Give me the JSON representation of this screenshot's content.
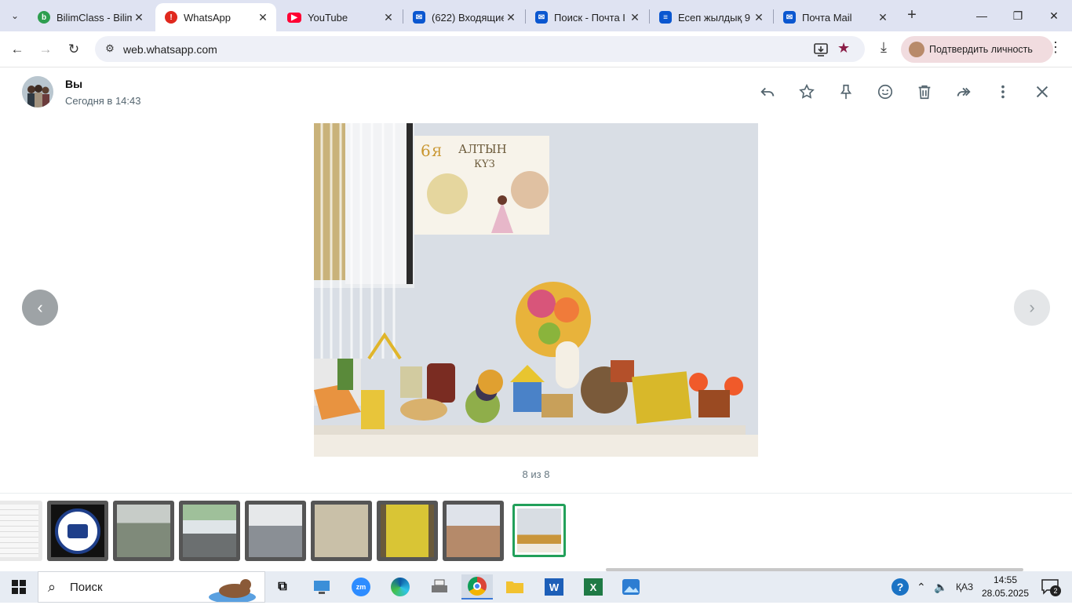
{
  "browser": {
    "tabs": [
      {
        "title": "BilimClass - Bilim",
        "favicon": "bilimclass-icon",
        "color": "#2e9e4f",
        "active": false
      },
      {
        "title": "WhatsApp",
        "favicon": "whatsapp-alert-icon",
        "color": "#e0291e",
        "active": true
      },
      {
        "title": "YouTube",
        "favicon": "youtube-icon",
        "color": "#ff0033",
        "active": false
      },
      {
        "title": "(622) Входящие",
        "favicon": "mail-icon",
        "color": "#0b57d0",
        "active": false
      },
      {
        "title": "Поиск - Почта I",
        "favicon": "mail-icon",
        "color": "#0b57d0",
        "active": false
      },
      {
        "title": "Есеп жылдық 9",
        "favicon": "docs-icon",
        "color": "#0b57d0",
        "active": false
      },
      {
        "title": "Почта Mail",
        "favicon": "mail-icon",
        "color": "#0b57d0",
        "active": false
      }
    ],
    "url": "web.whatsapp.com",
    "verify_label": "Подтвердить личность"
  },
  "viewer": {
    "sender": "Вы",
    "time": "Сегодня в 14:43",
    "counter": "8 из 8",
    "actions": [
      "reply-icon",
      "star-icon",
      "pin-icon",
      "emoji-icon",
      "delete-icon",
      "forward-icon",
      "more-icon",
      "close-icon"
    ]
  },
  "photo": {
    "poster_line1": "6",
    "poster_line2": "Я",
    "poster_title": "АЛТЫН",
    "poster_subtitle": "КҮЗ"
  },
  "thumbnails": [
    {
      "name": "thumb-document",
      "color": "#f2f2f2"
    },
    {
      "name": "thumb-logo",
      "color": "#1f3f8a"
    },
    {
      "name": "thumb-classroom-round-table",
      "color": "#7f8a7a"
    },
    {
      "name": "thumb-classroom-screen",
      "color": "#6b8c68"
    },
    {
      "name": "thumb-hall",
      "color": "#8a8f95"
    },
    {
      "name": "thumb-drawing",
      "color": "#c9c0a8"
    },
    {
      "name": "thumb-yellow-poster",
      "color": "#d9c535"
    },
    {
      "name": "thumb-group-photo",
      "color": "#b58a6a"
    },
    {
      "name": "thumb-autumn-table",
      "color": "#d8cdbd",
      "selected": true
    }
  ],
  "taskbar": {
    "search_placeholder": "Поиск",
    "apps": [
      "weather-otter-icon",
      "task-view-icon",
      "pc-icon",
      "zoom-icon",
      "edge-icon",
      "printer-icon",
      "chrome-icon",
      "folder-icon",
      "word-icon",
      "excel-icon",
      "photos-icon"
    ],
    "language": "ҚАЗ",
    "time": "14:55",
    "date": "28.05.2025",
    "notifications": "2"
  }
}
